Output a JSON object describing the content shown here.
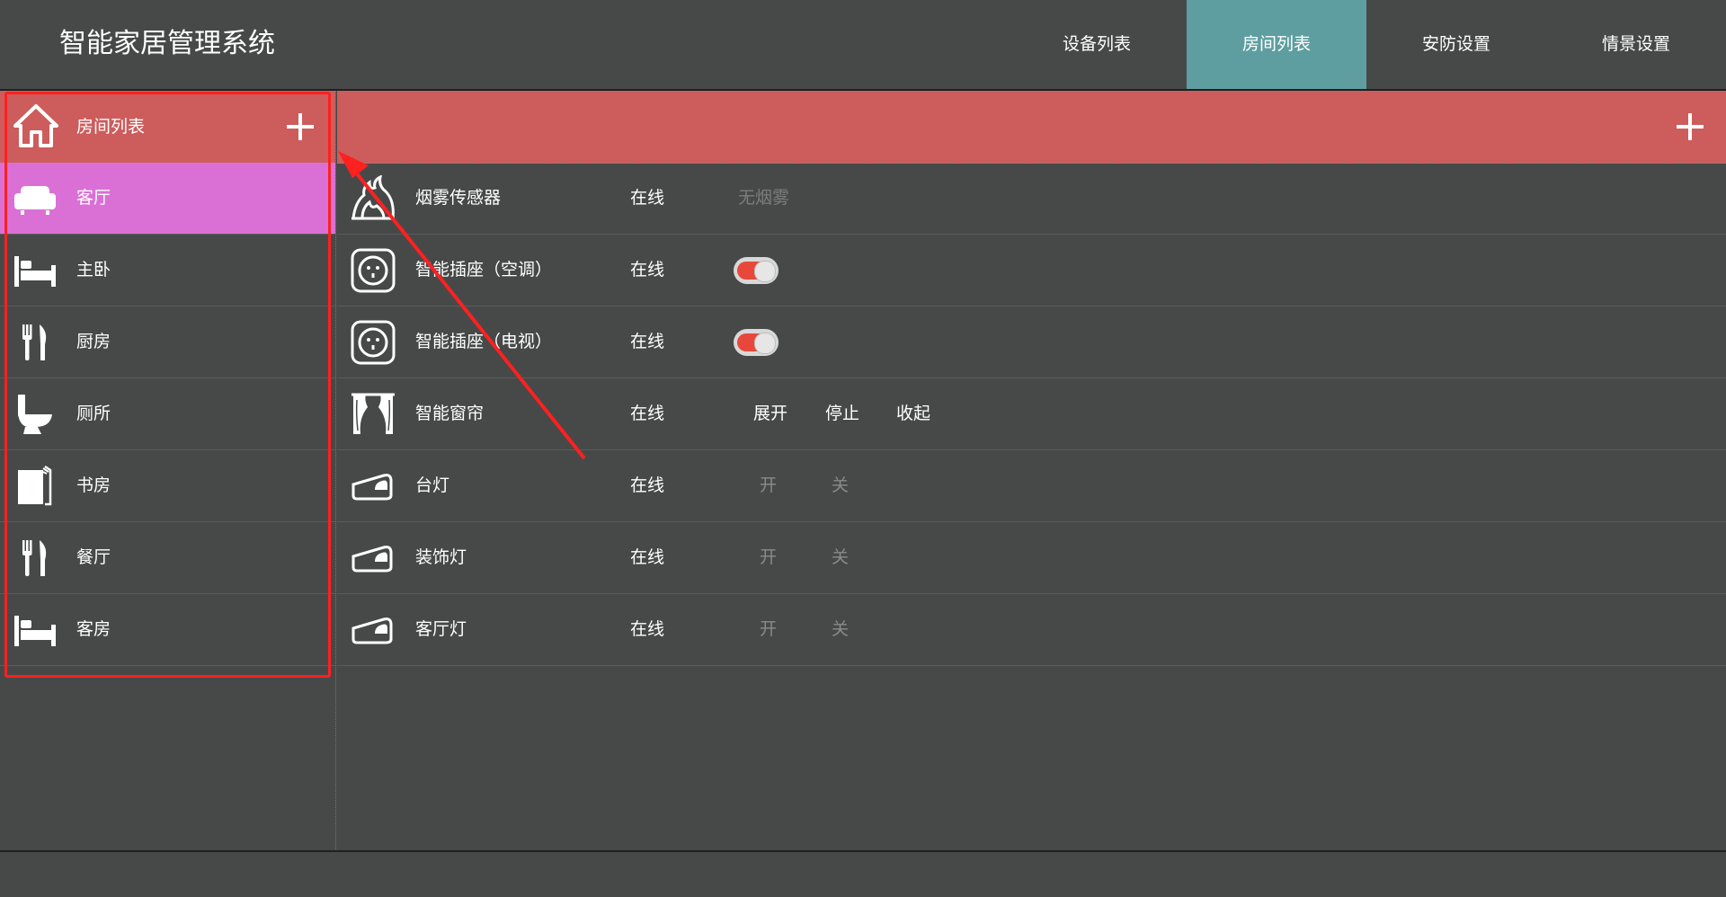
{
  "app": {
    "title": "智能家居管理系统"
  },
  "nav": {
    "tabs": [
      "设备列表",
      "房间列表",
      "安防设置",
      "情景设置"
    ],
    "active_index": 1
  },
  "sidebar": {
    "header_label": "房间列表",
    "rooms": [
      {
        "label": "客厅",
        "icon": "sofa-icon",
        "active": true
      },
      {
        "label": "主卧",
        "icon": "bed-icon"
      },
      {
        "label": "厨房",
        "icon": "fork-knife-icon"
      },
      {
        "label": "厕所",
        "icon": "toilet-icon"
      },
      {
        "label": "书房",
        "icon": "books-icon"
      },
      {
        "label": "餐厅",
        "icon": "fork-knife-icon"
      },
      {
        "label": "客房",
        "icon": "bed-icon"
      }
    ]
  },
  "devices": [
    {
      "name": "烟雾传感器",
      "status": "在线",
      "message": "无烟雾",
      "icon": "smoke-sensor-icon"
    },
    {
      "name": "智能插座（空调）",
      "status": "在线",
      "toggle_on": true,
      "icon": "socket-icon"
    },
    {
      "name": "智能插座（电视）",
      "status": "在线",
      "toggle_on": true,
      "icon": "socket-icon"
    },
    {
      "name": "智能窗帘",
      "status": "在线",
      "actions": [
        "展开",
        "停止",
        "收起"
      ],
      "icon": "curtain-icon"
    },
    {
      "name": "台灯",
      "status": "在线",
      "actions": [
        "开",
        "关"
      ],
      "icon": "light-switch-icon"
    },
    {
      "name": "装饰灯",
      "status": "在线",
      "actions": [
        "开",
        "关"
      ],
      "icon": "light-switch-icon"
    },
    {
      "name": "客厅灯",
      "status": "在线",
      "actions": [
        "开",
        "关"
      ],
      "icon": "light-switch-icon"
    }
  ],
  "colors": {
    "background": "#474949",
    "header_red": "#cd5c5c",
    "active_tab": "#5f9ea0",
    "active_room": "#da70d6",
    "annotation_red": "#ff2020",
    "toggle_on": "#e8483c"
  }
}
